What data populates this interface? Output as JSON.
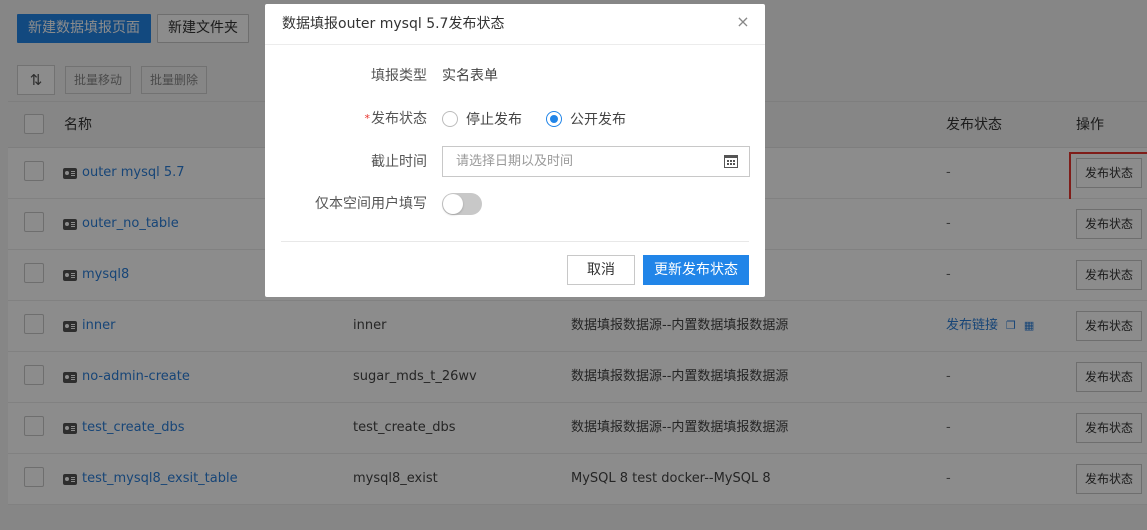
{
  "topbar": {
    "new_page_label": "新建数据填报页面",
    "new_folder_label": "新建文件夹"
  },
  "toolbar": {
    "sort_icon": "⇅",
    "batch_move_label": "批量移动",
    "batch_delete_label": "批量删除"
  },
  "table": {
    "headers": {
      "name": "名称",
      "publish_status": "发布状态",
      "ops": "操作"
    },
    "rows": [
      {
        "name": "outer mysql 5.7",
        "table": "",
        "source": "",
        "status": "-",
        "op": "发布状态"
      },
      {
        "name": "outer_no_table",
        "table": "",
        "source": "",
        "status": "-",
        "op": "发布状态"
      },
      {
        "name": "mysql8",
        "table": "",
        "source": "",
        "status": "-",
        "op": "发布状态"
      },
      {
        "name": "inner",
        "table": "inner",
        "source": "数据填报数据源--内置数据填报数据源",
        "status": "发布链接",
        "op": "发布状态"
      },
      {
        "name": "no-admin-create",
        "table": "sugar_mds_t_26wv",
        "source": "数据填报数据源--内置数据填报数据源",
        "status": "-",
        "op": "发布状态"
      },
      {
        "name": "test_create_dbs",
        "table": "test_create_dbs",
        "source": "数据填报数据源--内置数据填报数据源",
        "status": "-",
        "op": "发布状态"
      },
      {
        "name": "test_mysql8_exsit_table",
        "table": "mysql8_exist",
        "source": "MySQL 8 test docker--MySQL 8",
        "status": "-",
        "op": "发布状态"
      }
    ]
  },
  "dialog": {
    "title": "数据填报outer mysql 5.7发布状态",
    "close_icon": "×",
    "type_label": "填报类型",
    "type_value": "实名表单",
    "required_mark": "*",
    "status_label": "发布状态",
    "status_options": [
      "停止发布",
      "公开发布"
    ],
    "status_selected": "公开发布",
    "deadline_label": "截止时间",
    "deadline_placeholder": "请选择日期以及时间",
    "space_only_label": "仅本空间用户填写",
    "space_only_enabled": false,
    "cancel_label": "取消",
    "submit_label": "更新发布状态"
  },
  "colors": {
    "primary": "#2185e8",
    "link": "#2b7fd9",
    "highlight": "#e8332c"
  }
}
